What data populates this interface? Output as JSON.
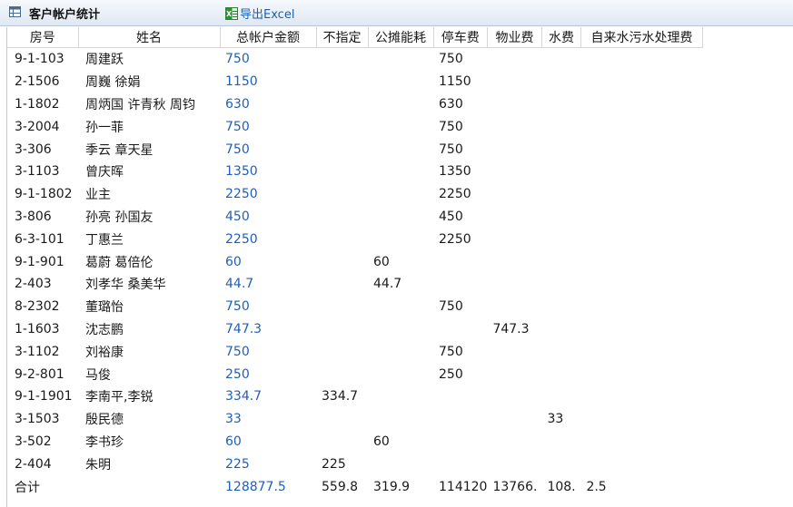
{
  "header": {
    "title": "客户帐户统计",
    "export_label": "导出Excel",
    "title_icon": "table-icon",
    "export_icon": "excel-icon"
  },
  "columns": [
    "房号",
    "姓名",
    "总帐户金额",
    "不指定",
    "公摊能耗",
    "停车费",
    "物业费",
    "水费",
    "自来水污水处理费"
  ],
  "rows": [
    [
      "9-1-103",
      "周建跃",
      "750",
      "",
      "",
      "750",
      "",
      "",
      ""
    ],
    [
      "2-1506",
      "周巍  徐娟",
      "1150",
      "",
      "",
      "1150",
      "",
      "",
      ""
    ],
    [
      "1-1802",
      "周炳国  许青秋  周钧",
      "630",
      "",
      "",
      "630",
      "",
      "",
      ""
    ],
    [
      "3-2004",
      "孙一菲",
      "750",
      "",
      "",
      "750",
      "",
      "",
      ""
    ],
    [
      "3-306",
      "季云  章天星",
      "750",
      "",
      "",
      "750",
      "",
      "",
      ""
    ],
    [
      "3-1103",
      "曾庆晖",
      "1350",
      "",
      "",
      "1350",
      "",
      "",
      ""
    ],
    [
      "9-1-1802",
      "业主",
      "2250",
      "",
      "",
      "2250",
      "",
      "",
      ""
    ],
    [
      "3-806",
      "孙亮  孙国友",
      "450",
      "",
      "",
      "450",
      "",
      "",
      ""
    ],
    [
      "6-3-101",
      "丁惠兰",
      "2250",
      "",
      "",
      "2250",
      "",
      "",
      ""
    ],
    [
      "9-1-901",
      "葛蔚 葛倍伦",
      "60",
      "",
      "60",
      "",
      "",
      "",
      ""
    ],
    [
      "2-403",
      "刘孝华  桑美华",
      "44.7",
      "",
      "44.7",
      "",
      "",
      "",
      ""
    ],
    [
      "8-2302",
      "董璐怡",
      "750",
      "",
      "",
      "750",
      "",
      "",
      ""
    ],
    [
      "1-1603",
      "沈志鹏",
      "747.3",
      "",
      "",
      "",
      "747.3",
      "",
      ""
    ],
    [
      "3-1102",
      "刘裕康",
      "750",
      "",
      "",
      "750",
      "",
      "",
      ""
    ],
    [
      "9-2-801",
      "马俊",
      "250",
      "",
      "",
      "250",
      "",
      "",
      ""
    ],
    [
      "9-1-1901",
      "李南平,李锐",
      "334.7",
      "334.7",
      "",
      "",
      "",
      "",
      ""
    ],
    [
      "3-1503",
      "殷民德",
      "33",
      "",
      "",
      "",
      "",
      "33",
      ""
    ],
    [
      "3-502",
      "李书珍",
      "60",
      "",
      "60",
      "",
      "",
      "",
      ""
    ],
    [
      "2-404",
      "朱明",
      "225",
      "225",
      "",
      "",
      "",
      "",
      ""
    ]
  ],
  "totals": [
    "合计",
    "",
    "128877.5",
    "559.8",
    "319.9",
    "114120",
    "13766.",
    "108.",
    "2.5"
  ]
}
